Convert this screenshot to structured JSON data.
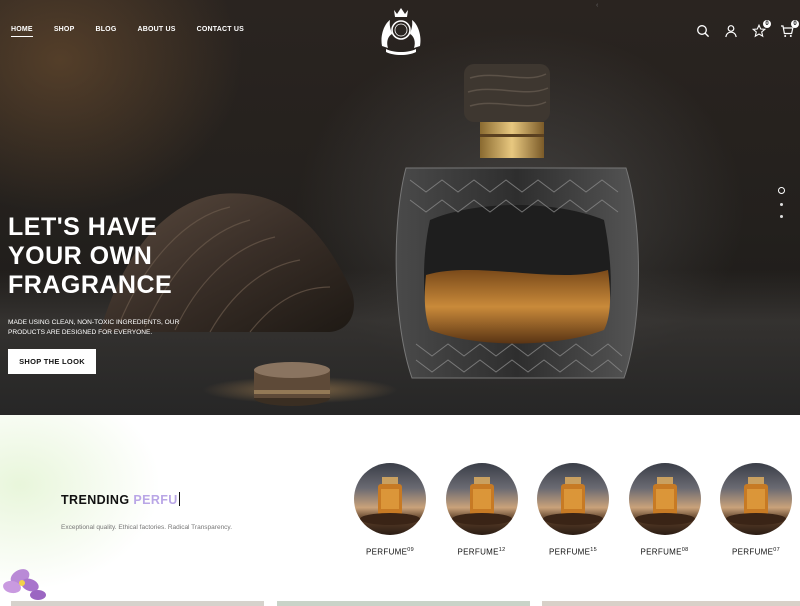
{
  "nav": {
    "items": [
      {
        "label": "HOME",
        "active": true
      },
      {
        "label": "SHOP"
      },
      {
        "label": "BLOG"
      },
      {
        "label": "ABOUT US"
      },
      {
        "label": "CONTACT US"
      }
    ]
  },
  "header_icons": {
    "search": "search-icon",
    "account": "user-icon",
    "wishlist": {
      "icon": "star-icon",
      "count": "0"
    },
    "cart": {
      "icon": "cart-icon",
      "count": "0"
    }
  },
  "hero": {
    "title_lines": [
      "LET'S HAVE",
      "YOUR OWN",
      "FRAGRANCE"
    ],
    "subtitle": "MADE USING CLEAN, NON-TOXIC INGREDIENTS, OUR PRODUCTS ARE DESIGNED FOR EVERYONE.",
    "cta": "SHOP THE LOOK",
    "slides": 3,
    "active_slide": 1
  },
  "trending": {
    "title_main": "TRENDING",
    "title_typed": "PERFU",
    "subtitle": "Exceptional quality. Ethical factories. Radical Transparency.",
    "products": [
      {
        "name": "PERFUME",
        "sup": "09"
      },
      {
        "name": "PERFUME",
        "sup": "12"
      },
      {
        "name": "PERFUME",
        "sup": "15"
      },
      {
        "name": "PERFUME",
        "sup": "08"
      },
      {
        "name": "PERFUME",
        "sup": "07"
      }
    ]
  },
  "colors": {
    "hero_dark": "#23201d",
    "accent_lilac": "#b9a6e6",
    "amber": "#c98a3a"
  }
}
